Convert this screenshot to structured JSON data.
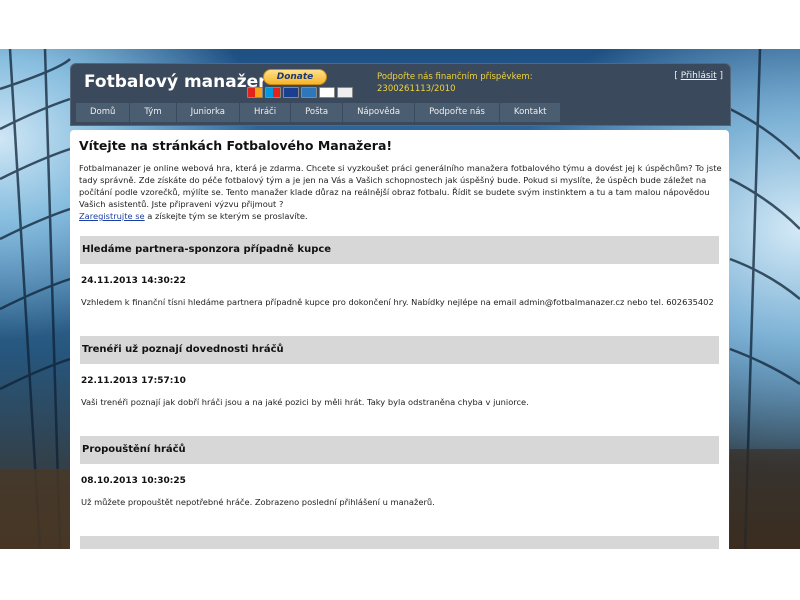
{
  "header": {
    "site_title": "Fotbalový manažer",
    "donate_label": "Donate",
    "support_line1": "Podpořte nás finančním příspěvkem:",
    "support_line2": "2300261113/2010",
    "login_open": "[ ",
    "login_label": "Přihlásit",
    "login_close": " ]",
    "payment_icons": [
      "mastercard-icon",
      "maestro-icon",
      "visa-icon",
      "amex-icon",
      "discover-icon",
      "echeck-icon"
    ]
  },
  "nav": {
    "items": [
      "Domů",
      "Tým",
      "Juniorka",
      "Hráči",
      "Pošta",
      "Nápověda",
      "Podpořte nás",
      "Kontakt"
    ]
  },
  "main": {
    "welcome_title": "Vítejte na stránkách Fotbalového Manažera!",
    "intro_text": "Fotbalmanazer je online webová hra, která je zdarma. Chcete si vyzkoušet práci generálního manažera fotbalového týmu a dovést jej k úspěchům? To jste tady správně. Zde získáte do péče fotbalový tým a je jen na Vás a Vašich schopnostech jak úspěšný bude. Pokud si myslíte, že úspěch bude záležet na počítání podle vzorečků, mýlíte se. Tento manažer klade důraz na reálnější obraz fotbalu. Řídit se budete svým instinktem a tu a tam malou nápovědou Vašich asistentů. Jste připraveni výzvu přijmout ?",
    "register_link": "Zaregistrujte se",
    "register_suffix": " a získejte tým se kterým se proslavíte."
  },
  "news": [
    {
      "title": "Hledáme partnera-sponzora případně kupce",
      "date": "24.11.2013 14:30:22",
      "text": "Vzhledem k finanční tísni hledáme partnera případně kupce pro dokončení hry. Nabídky nejlépe na email admin@fotbalmanazer.cz nebo tel. 602635402"
    },
    {
      "title": "Trenéři už poznají dovednosti hráčů",
      "date": "22.11.2013 17:57:10",
      "text": "Vaši trenéři poznají jak dobří hráči jsou a na jaké pozici by měli hrát. Taky byla odstraněna chyba v juniorce."
    },
    {
      "title": "Propouštění hráčů",
      "date": "08.10.2013 10:30:25",
      "text": "Už můžete propouštět nepotřebné hráče. Zobrazeno poslední přihlášení u manažerů."
    },
    {
      "title": "",
      "date": "",
      "text": ""
    }
  ]
}
